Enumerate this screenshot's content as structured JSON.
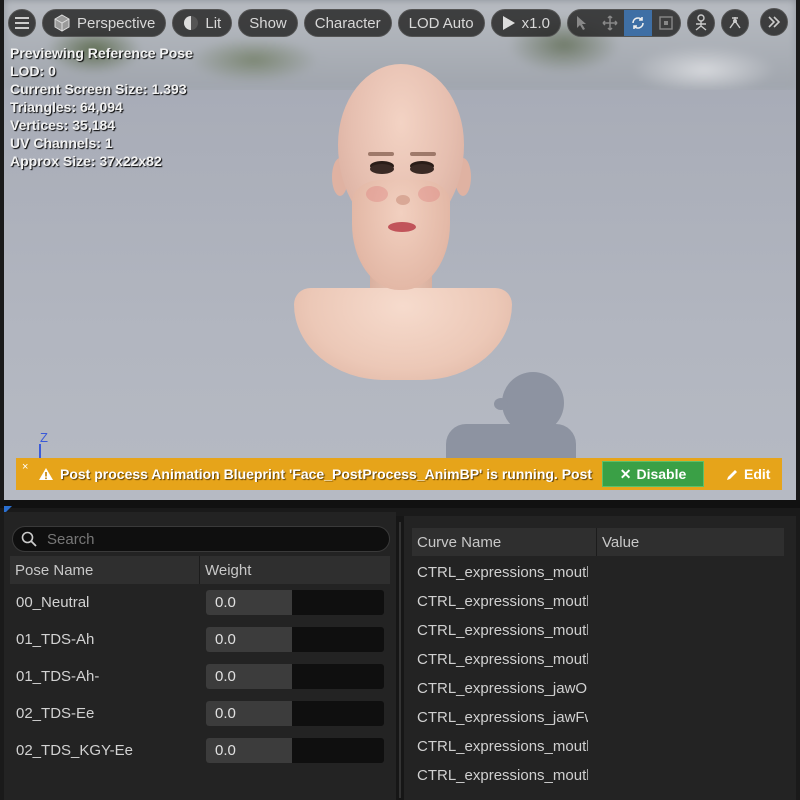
{
  "toolbar": {
    "menu_icon": "hamburger-icon",
    "perspective_label": "Perspective",
    "lit_label": "Lit",
    "show_label": "Show",
    "character_label": "Character",
    "lod_label": "LOD Auto",
    "play_speed_label": "x1.0",
    "transform_tools": [
      "select-icon",
      "translate-icon",
      "rotate-icon",
      "scale-icon"
    ],
    "active_tool": "rotate-icon",
    "extra_icons": [
      "camera-icon",
      "bone-icon",
      "chevron-double-right-icon"
    ]
  },
  "viewport_stats": {
    "line1": "Previewing Reference Pose",
    "line2": "LOD: 0",
    "line3": "Current Screen Size: 1.393",
    "line4": "Triangles: 64,094",
    "line5": "Vertices: 35,184",
    "line6": "UV Channels: 1",
    "line7": "Approx Size: 37x22x82"
  },
  "axis_label": "Z",
  "warning": {
    "close_glyph": "×",
    "message": "Post process Animation Blueprint 'Face_PostProcess_AnimBP' is running. Post process",
    "disable_label": "Disable",
    "edit_label": "Edit",
    "color": "#e6a41a",
    "disable_color": "#3aa046"
  },
  "pose_panel": {
    "search_placeholder": "Search",
    "col_pose_name": "Pose Name",
    "col_weight": "Weight",
    "rows": [
      {
        "name": "00_Neutral",
        "weight": "0.0"
      },
      {
        "name": "01_TDS-Ah",
        "weight": "0.0"
      },
      {
        "name": "01_TDS-Ah-",
        "weight": "0.0"
      },
      {
        "name": "02_TDS-Ee",
        "weight": "0.0"
      },
      {
        "name": "02_TDS_KGY-Ee",
        "weight": "0.0"
      }
    ]
  },
  "curve_panel": {
    "col_curve_name": "Curve Name",
    "col_value": "Value",
    "rows": [
      "CTRL_expressions_mouthL",
      "CTRL_expressions_mouthU",
      "CTRL_expressions_mouthL",
      "CTRL_expressions_mouthL",
      "CTRL_expressions_jawOpen",
      "CTRL_expressions_jawFwd",
      "CTRL_expressions_mouthU",
      "CTRL_expressions_mouthU"
    ]
  }
}
